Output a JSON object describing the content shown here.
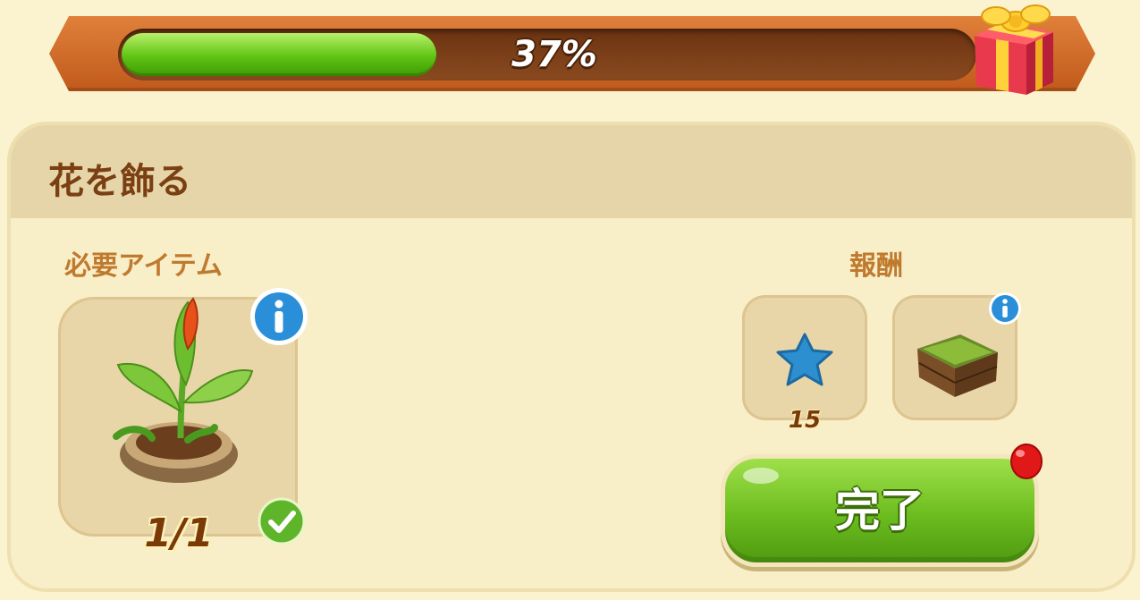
{
  "progress": {
    "value_percent": 37,
    "label": "37%",
    "reward_icon": "gift-box-icon"
  },
  "task": {
    "title": "花を飾る",
    "required_label": "必要アイテム",
    "required_item": {
      "icon": "flower-seedling-pot-icon",
      "count_text": "1/1",
      "completed_icon": "check-icon",
      "info_icon": "info-icon"
    },
    "rewards_label": "報酬",
    "rewards": [
      {
        "icon": "blue-star-icon",
        "quantity": "15"
      },
      {
        "icon": "grass-crate-icon",
        "info_icon": "info-icon"
      }
    ],
    "complete_button": {
      "label": "完了",
      "notification_icon": "red-balloon-dot-icon"
    }
  },
  "colors": {
    "background": "#fbf3cf",
    "bar_frame": "#c05a1c",
    "bar_fill": "#5fc412",
    "title_text": "#7a3f12",
    "section_label": "#c07a2e",
    "button_green": "#6cbc1f",
    "notification_red": "#e01818"
  }
}
